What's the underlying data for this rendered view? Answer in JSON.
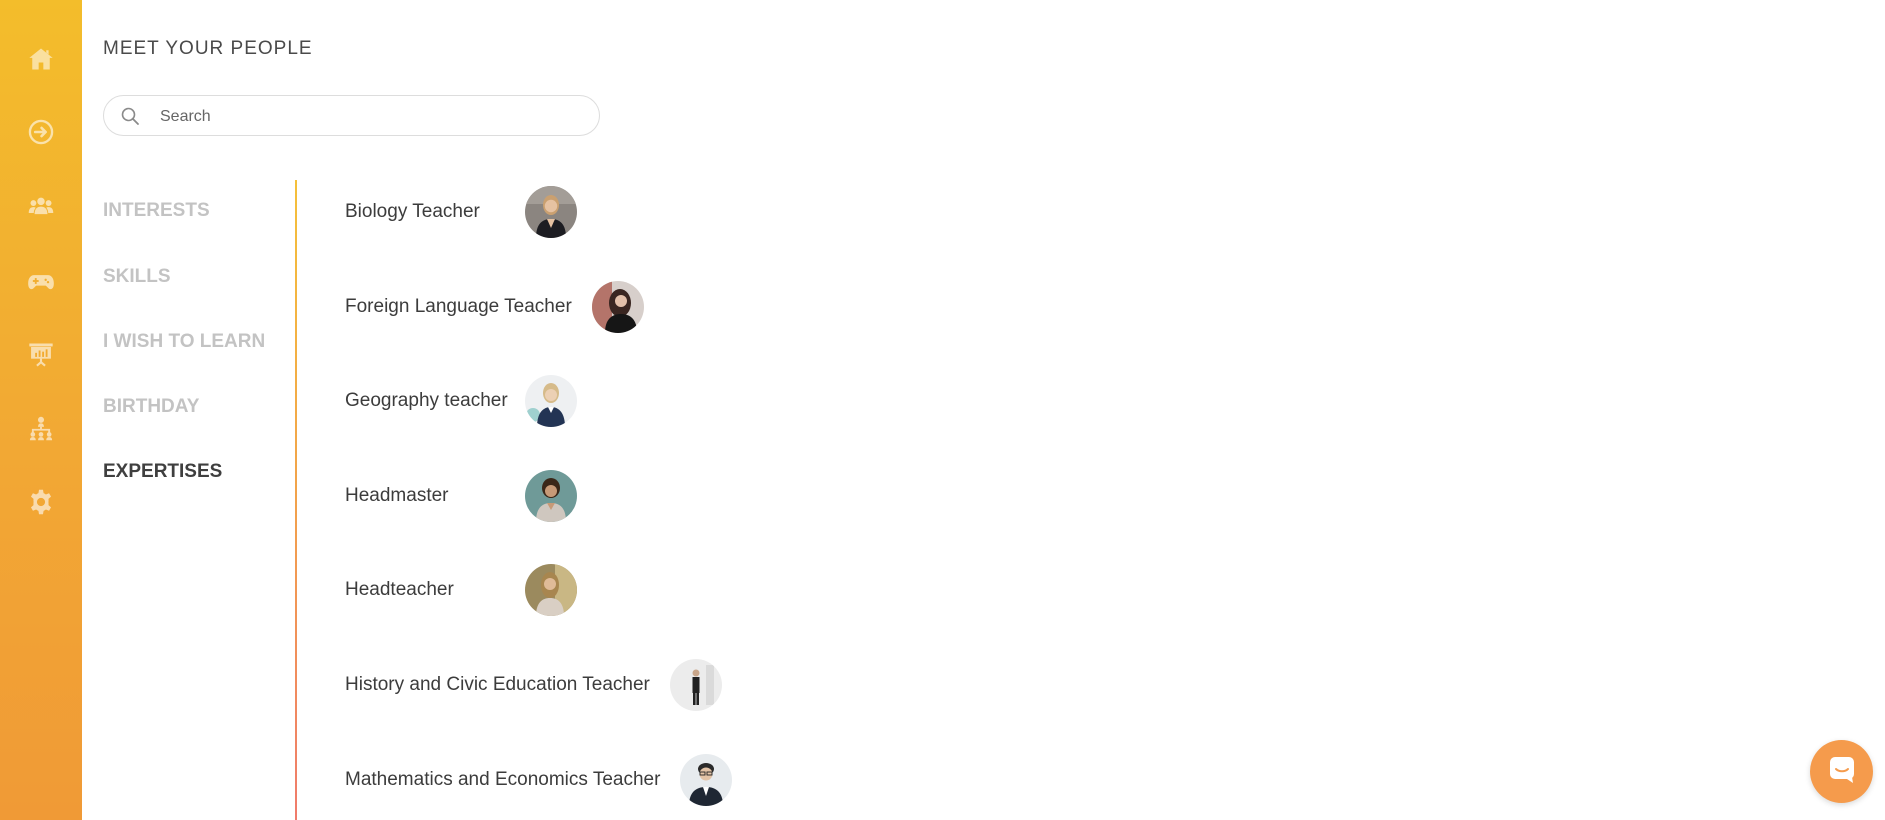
{
  "sidebar": {
    "icons": [
      {
        "name": "home-icon"
      },
      {
        "name": "arrow-circle-right-icon"
      },
      {
        "name": "people-icon"
      },
      {
        "name": "gamepad-icon"
      },
      {
        "name": "presentation-board-icon"
      },
      {
        "name": "org-chart-icon"
      },
      {
        "name": "gear-icon"
      }
    ],
    "gradient_top": "#f3bd2b",
    "gradient_bottom": "#f09a36"
  },
  "header": {
    "title": "MEET YOUR PEOPLE"
  },
  "search": {
    "placeholder": "Search",
    "value": ""
  },
  "categories": [
    {
      "label": "INTERESTS",
      "active": false
    },
    {
      "label": "SKILLS",
      "active": false
    },
    {
      "label": "I WISH TO LEARN",
      "active": false
    },
    {
      "label": "BIRTHDAY",
      "active": false
    },
    {
      "label": "EXPERTISES",
      "active": true
    }
  ],
  "expertises": [
    {
      "label": "Biology Teacher"
    },
    {
      "label": "Foreign Language Teacher"
    },
    {
      "label": "Geography teacher"
    },
    {
      "label": "Headmaster"
    },
    {
      "label": "Headteacher"
    },
    {
      "label": "History and Civic Education Teacher"
    },
    {
      "label": "Mathematics and Economics Teacher"
    }
  ],
  "colors": {
    "accent": "#f2a834",
    "chat_button": "#f59b4c",
    "active_text": "#3f3f3f",
    "inactive_text": "#c3c3c3"
  }
}
